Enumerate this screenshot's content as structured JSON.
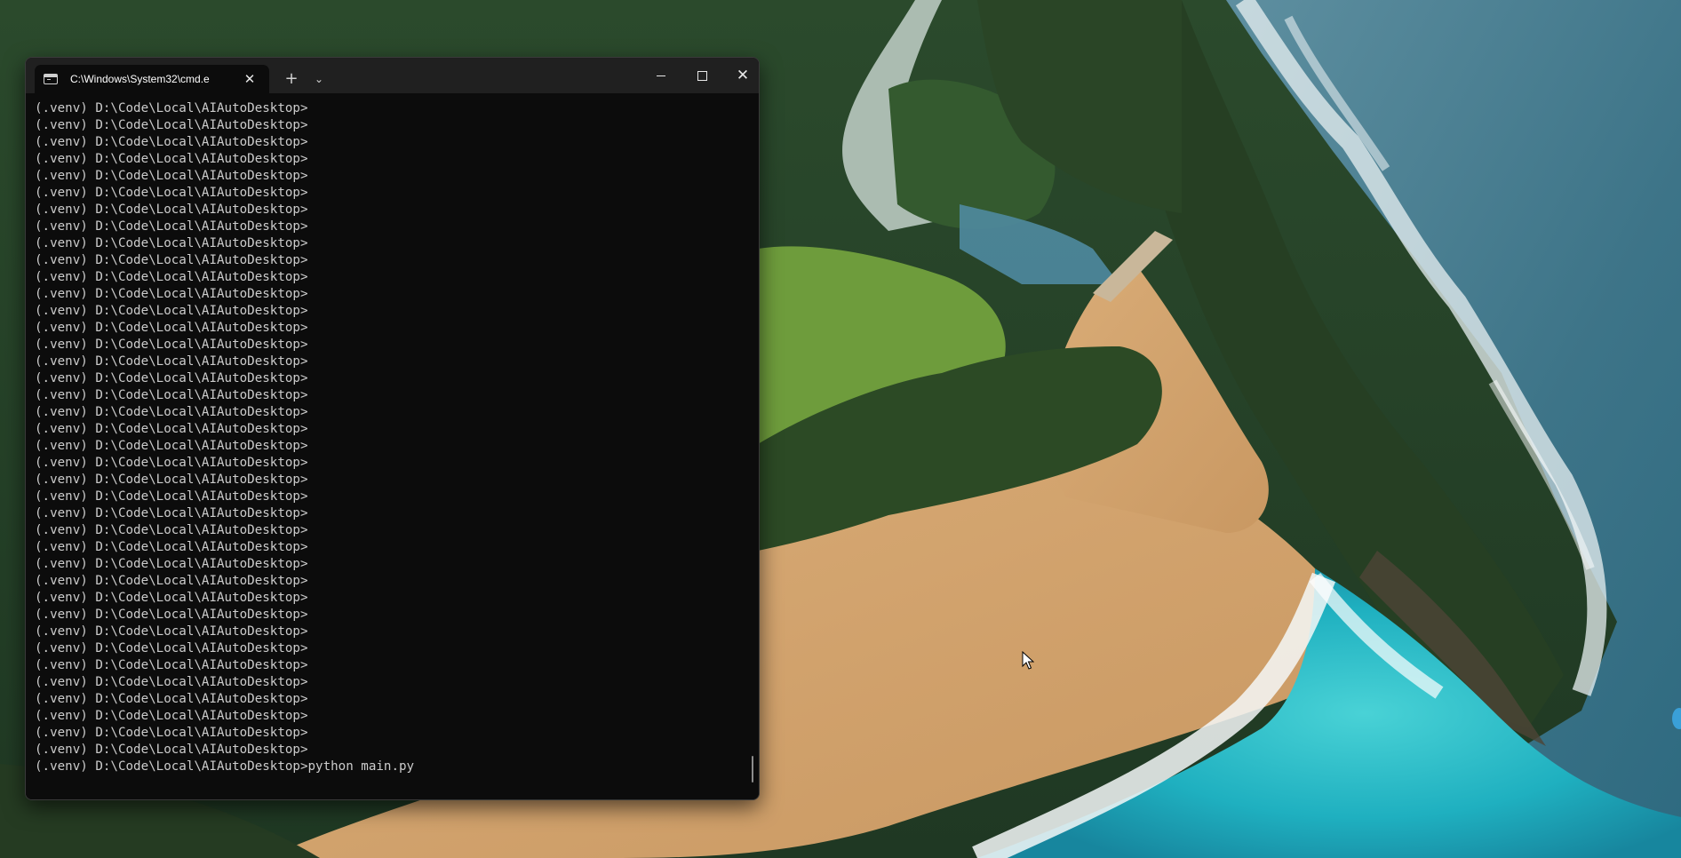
{
  "desktop": {
    "wallpaper_name": "aerial-coastline-wallpaper",
    "colors": {
      "ocean_deep": "#4a7f92",
      "ocean_turquoise": "#2bb7c4",
      "sand": "#d3a46e",
      "forest": "#2f4a2a",
      "meadow": "#6b9a3a"
    }
  },
  "terminal": {
    "tab_title": "C:\\Windows\\System32\\cmd.e",
    "tab_close_symbol": "✕",
    "new_tab_symbol": "+",
    "dropdown_symbol": "⌄",
    "close_symbol": "✕",
    "lines": [
      "(.venv) D:\\Code\\Local\\AIAutoDesktop>",
      "(.venv) D:\\Code\\Local\\AIAutoDesktop>",
      "(.venv) D:\\Code\\Local\\AIAutoDesktop>",
      "(.venv) D:\\Code\\Local\\AIAutoDesktop>",
      "(.venv) D:\\Code\\Local\\AIAutoDesktop>",
      "(.venv) D:\\Code\\Local\\AIAutoDesktop>",
      "(.venv) D:\\Code\\Local\\AIAutoDesktop>",
      "(.venv) D:\\Code\\Local\\AIAutoDesktop>",
      "(.venv) D:\\Code\\Local\\AIAutoDesktop>",
      "(.venv) D:\\Code\\Local\\AIAutoDesktop>",
      "(.venv) D:\\Code\\Local\\AIAutoDesktop>",
      "(.venv) D:\\Code\\Local\\AIAutoDesktop>",
      "(.venv) D:\\Code\\Local\\AIAutoDesktop>",
      "(.venv) D:\\Code\\Local\\AIAutoDesktop>",
      "(.venv) D:\\Code\\Local\\AIAutoDesktop>",
      "(.venv) D:\\Code\\Local\\AIAutoDesktop>",
      "(.venv) D:\\Code\\Local\\AIAutoDesktop>",
      "(.venv) D:\\Code\\Local\\AIAutoDesktop>",
      "(.venv) D:\\Code\\Local\\AIAutoDesktop>",
      "(.venv) D:\\Code\\Local\\AIAutoDesktop>",
      "(.venv) D:\\Code\\Local\\AIAutoDesktop>",
      "(.venv) D:\\Code\\Local\\AIAutoDesktop>",
      "(.venv) D:\\Code\\Local\\AIAutoDesktop>",
      "(.venv) D:\\Code\\Local\\AIAutoDesktop>",
      "(.venv) D:\\Code\\Local\\AIAutoDesktop>",
      "(.venv) D:\\Code\\Local\\AIAutoDesktop>",
      "(.venv) D:\\Code\\Local\\AIAutoDesktop>",
      "(.venv) D:\\Code\\Local\\AIAutoDesktop>",
      "(.venv) D:\\Code\\Local\\AIAutoDesktop>",
      "(.venv) D:\\Code\\Local\\AIAutoDesktop>",
      "(.venv) D:\\Code\\Local\\AIAutoDesktop>",
      "(.venv) D:\\Code\\Local\\AIAutoDesktop>",
      "(.venv) D:\\Code\\Local\\AIAutoDesktop>",
      "(.venv) D:\\Code\\Local\\AIAutoDesktop>",
      "(.venv) D:\\Code\\Local\\AIAutoDesktop>",
      "(.venv) D:\\Code\\Local\\AIAutoDesktop>",
      "(.venv) D:\\Code\\Local\\AIAutoDesktop>",
      "(.venv) D:\\Code\\Local\\AIAutoDesktop>",
      "(.venv) D:\\Code\\Local\\AIAutoDesktop>",
      "(.venv) D:\\Code\\Local\\AIAutoDesktop>python main.py"
    ],
    "colors": {
      "background": "#0c0c0c",
      "titlebar": "#202020",
      "text": "#cccccc"
    }
  }
}
